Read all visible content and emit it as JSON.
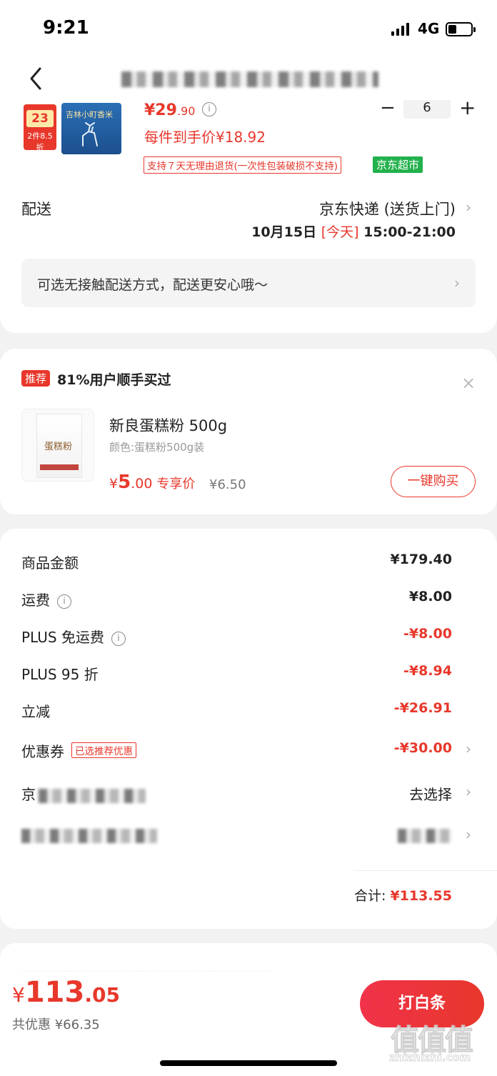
{
  "status_bar": {
    "time": "9:21",
    "network": "4G"
  },
  "product": {
    "badge_price": "23",
    "badge_promo": "2件8.5折",
    "image_text": "吉林小町香米",
    "price_main": "¥29",
    "price_decimal": ".90",
    "quantity": "6",
    "unit_price": "每件到手价¥18.92",
    "return_policy": "支持７天无理由退货(一次性包装破损不支持)",
    "store_tag": "京东超市"
  },
  "shipping": {
    "label": "配送",
    "method": "京东快递 (送货上门)",
    "date": "10月15日",
    "today": "[今天]",
    "window": "15:00-21:00",
    "contactless": "可选无接触配送方式，配送更安心哦～"
  },
  "recommend": {
    "tag": "推荐",
    "title": "81%用户顺手买过",
    "item_name": "新良蛋糕粉 500g",
    "item_spec": "颜色:蛋糕粉500g装",
    "item_image_text": "蛋糕粉",
    "price_currency": "¥",
    "price_int": "5",
    "price_dec": ".00",
    "price_label": "专享价",
    "original_price": "¥6.50",
    "buy_button": "一键购买"
  },
  "summary": {
    "rows": [
      {
        "label": "商品金额",
        "value": "¥179.40"
      },
      {
        "label": "运费",
        "value": "¥8.00"
      },
      {
        "label": "PLUS 免运费",
        "value": "-¥8.00"
      },
      {
        "label": "PLUS 95 折",
        "value": "-¥8.94"
      },
      {
        "label": "立减",
        "value": "-¥26.91"
      },
      {
        "label": "优惠券",
        "tag": "已选推荐优惠",
        "value": "-¥30.00"
      },
      {
        "label": "京",
        "value": "去选择"
      }
    ],
    "total_label": "合计:",
    "total_value": "¥113.55"
  },
  "bottom": {
    "currency": "¥",
    "amount_int": "113",
    "amount_dec": ".05",
    "saved": "共优惠 ¥66.35",
    "pay_button": "打白条",
    "watermark": "值值值",
    "watermark_url": "zhizhizhi.com"
  },
  "colors": {
    "accent": "#e8372b",
    "store_green": "#22b14c",
    "background": "#f2f2f2"
  },
  "icons": [
    "back-chevron-icon",
    "info-icon",
    "chevron-right-icon",
    "close-icon",
    "signal-icon",
    "battery-icon"
  ]
}
